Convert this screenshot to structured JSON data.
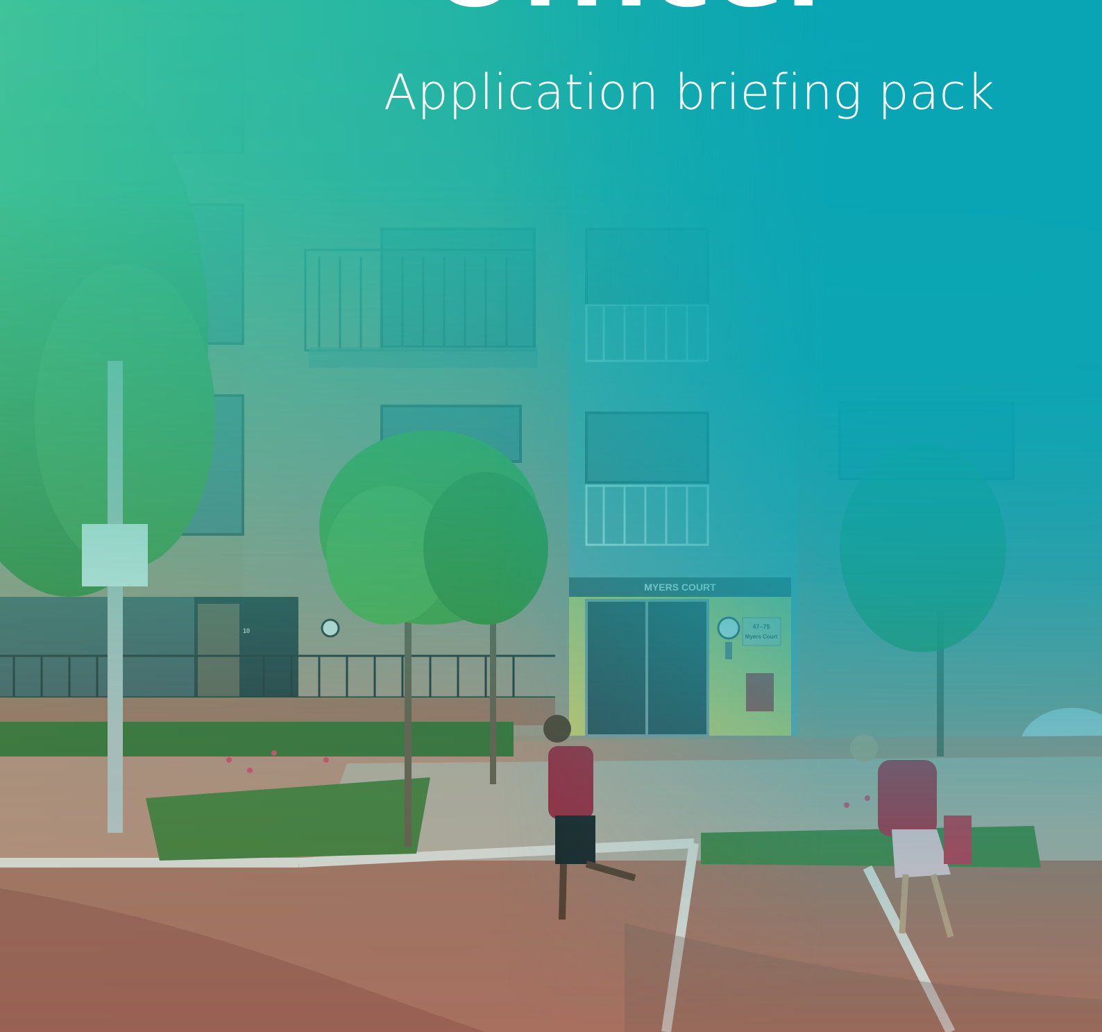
{
  "cover": {
    "title": "Officer",
    "subtitle": "Application briefing pack"
  },
  "photo": {
    "building_sign": "MYERS COURT",
    "door_number": "10",
    "plaque_line1": "47–75",
    "plaque_line2": "Myers Court"
  },
  "colors": {
    "overlay_green": "#3ec39a",
    "overlay_teal": "#0aa5b4",
    "brick": "#b98f7a",
    "paving": "#b07a6c",
    "tree_green": "#4f9b3a"
  }
}
